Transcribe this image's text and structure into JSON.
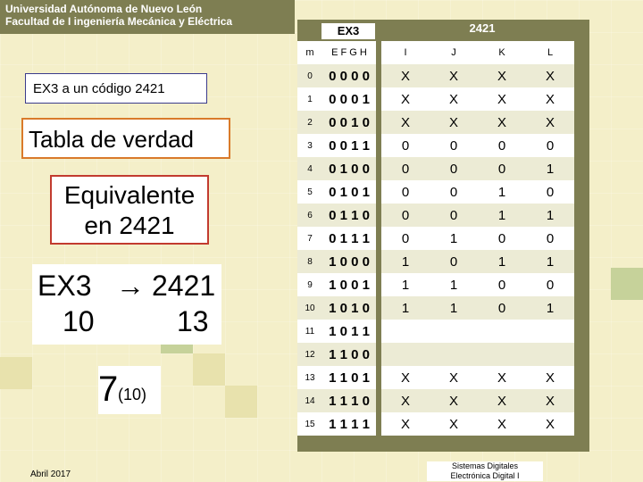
{
  "header": {
    "line1": "Universidad Autónoma de Nuevo León",
    "line2": "Facultad de I ingeniería Mecánica y Eléctrica"
  },
  "left": {
    "label1": "EX3 a  un código 2421",
    "label2": "Tabla de verdad",
    "label3_l1": "Equivalente",
    "label3_l2": "en 2421",
    "ex3": "EX3",
    "arrow": "→",
    "to2421": "2421",
    "val10": "10",
    "val13": "13",
    "seven": "7",
    "sub": "(10)"
  },
  "table": {
    "ex3_title": "EX3",
    "code_title": "2421",
    "headers": [
      "m",
      "E F G H",
      "I",
      "J",
      "K",
      "L"
    ],
    "rows": [
      [
        "0",
        "0 0 0 0",
        "X",
        "X",
        "X",
        "X"
      ],
      [
        "1",
        "0 0 0 1",
        "X",
        "X",
        "X",
        "X"
      ],
      [
        "2",
        "0 0 1 0",
        "X",
        "X",
        "X",
        "X"
      ],
      [
        "3",
        "0 0 1 1",
        "0",
        "0",
        "0",
        "0"
      ],
      [
        "4",
        "0 1 0 0",
        "0",
        "0",
        "0",
        "1"
      ],
      [
        "5",
        "0 1 0 1",
        "0",
        "0",
        "1",
        "0"
      ],
      [
        "6",
        "0 1 1 0",
        "0",
        "0",
        "1",
        "1"
      ],
      [
        "7",
        "0 1 1 1",
        "0",
        "1",
        "0",
        "0"
      ],
      [
        "8",
        "1 0 0 0",
        "1",
        "0",
        "1",
        "1"
      ],
      [
        "9",
        "1 0 0 1",
        "1",
        "1",
        "0",
        "0"
      ],
      [
        "10",
        "1 0 1 0",
        "1",
        "1",
        "0",
        "1"
      ],
      [
        "11",
        "1 0 1 1",
        "",
        "",
        "",
        ""
      ],
      [
        "12",
        "1 1 0 0",
        "",
        "",
        "",
        ""
      ],
      [
        "13",
        "1 1 0 1",
        "X",
        "X",
        "X",
        "X"
      ],
      [
        "14",
        "1 1 1 0",
        "X",
        "X",
        "X",
        "X"
      ],
      [
        "15",
        "1 1 1 1",
        "X",
        "X",
        "X",
        "X"
      ]
    ]
  },
  "footer": {
    "date": "Abril 2017",
    "course1": "Sistemas Digitales",
    "course2": "Electrónica Digital I"
  }
}
